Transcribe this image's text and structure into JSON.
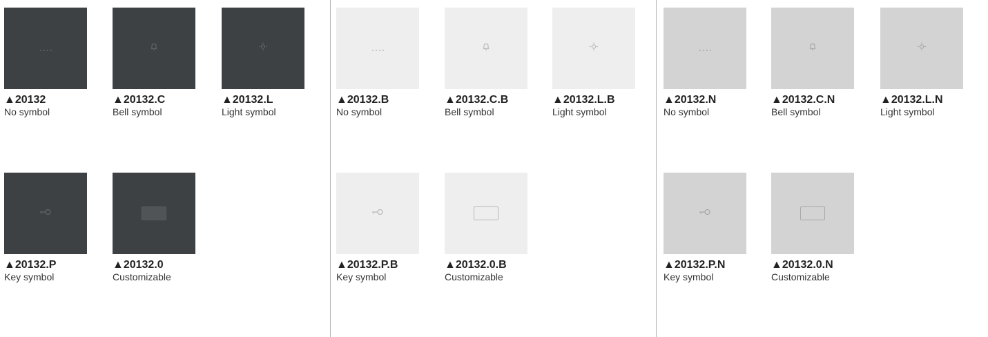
{
  "colors": {
    "dark": "#3d4144",
    "white": "#eeeeee",
    "grey": "#d3d3d3",
    "divider": "#b5b5b5"
  },
  "series": [
    {
      "finish": "dark",
      "items": [
        {
          "code": "▲20132",
          "label": "No symbol",
          "symbol": "dots-icon"
        },
        {
          "code": "▲20132.C",
          "label": "Bell symbol",
          "symbol": "bell-icon"
        },
        {
          "code": "▲20132.L",
          "label": "Light symbol",
          "symbol": "light-icon"
        },
        {
          "code": "▲20132.P",
          "label": "Key symbol",
          "symbol": "key-icon"
        },
        {
          "code": "▲20132.0",
          "label": "Customizable",
          "symbol": "label-window-icon"
        }
      ]
    },
    {
      "finish": "white",
      "items": [
        {
          "code": "▲20132.B",
          "label": "No symbol",
          "symbol": "dots-icon"
        },
        {
          "code": "▲20132.C.B",
          "label": "Bell symbol",
          "symbol": "bell-icon"
        },
        {
          "code": "▲20132.L.B",
          "label": "Light symbol",
          "symbol": "light-icon"
        },
        {
          "code": "▲20132.P.B",
          "label": "Key symbol",
          "symbol": "key-icon"
        },
        {
          "code": "▲20132.0.B",
          "label": "Customizable",
          "symbol": "label-window-icon"
        }
      ]
    },
    {
      "finish": "grey",
      "items": [
        {
          "code": "▲20132.N",
          "label": "No symbol",
          "symbol": "dots-icon"
        },
        {
          "code": "▲20132.C.N",
          "label": "Bell symbol",
          "symbol": "bell-icon"
        },
        {
          "code": "▲20132.L.N",
          "label": "Light symbol",
          "symbol": "light-icon"
        },
        {
          "code": "▲20132.P.N",
          "label": "Key symbol",
          "symbol": "key-icon"
        },
        {
          "code": "▲20132.0.N",
          "label": "Customizable",
          "symbol": "label-window-icon"
        }
      ]
    }
  ]
}
